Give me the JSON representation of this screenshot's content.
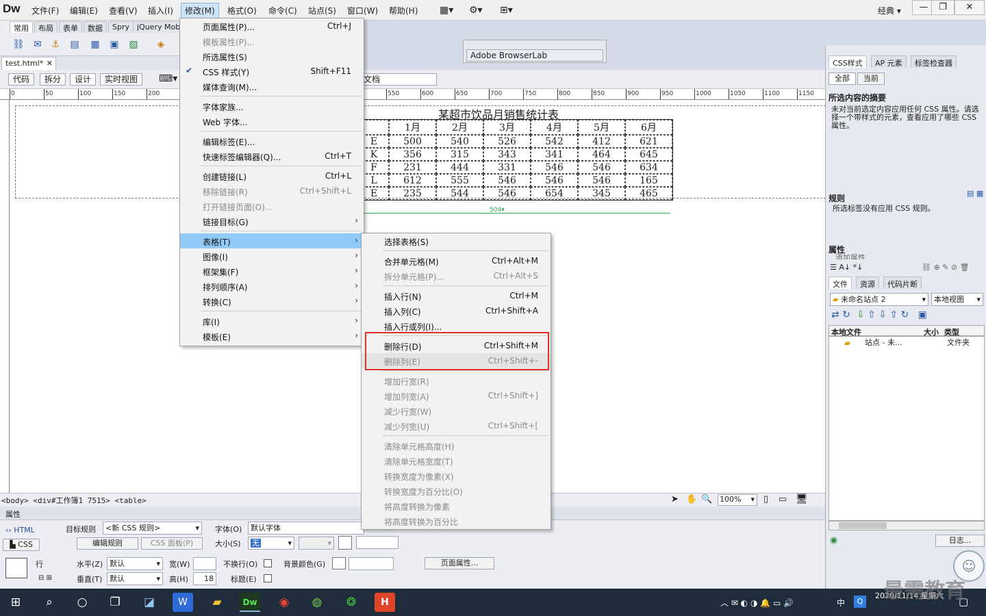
{
  "app": {
    "logo": "Dw",
    "workspace": "经典",
    "menubar": [
      "文件(F)",
      "编辑(E)",
      "查看(V)",
      "插入(I)",
      "修改(M)",
      "格式(O)",
      "命令(C)",
      "站点(S)",
      "窗口(W)",
      "帮助(H)"
    ]
  },
  "insert_panel": {
    "tabs": [
      "常用",
      "布局",
      "表单",
      "数据",
      "Spry",
      "jQuery Mob"
    ]
  },
  "document": {
    "tab": "test.html*",
    "view_buttons": [
      "代码",
      "拆分",
      "设计",
      "实时视图"
    ],
    "title_value": "文档",
    "ruler_labels": [
      "0",
      "50",
      "100",
      "150",
      "200",
      "550",
      "600",
      "650",
      "700",
      "750",
      "800",
      "850",
      "900",
      "950",
      "1000",
      "1050",
      "1100",
      "1150"
    ],
    "table_title": "某超市饮品月销售统计表",
    "table": {
      "header": [
        "",
        "1月",
        "2月",
        "3月",
        "4月",
        "5月",
        "6月"
      ],
      "rows": [
        [
          "E",
          "500",
          "540",
          "526",
          "542",
          "412",
          "621"
        ],
        [
          "K",
          "356",
          "315",
          "343",
          "341",
          "464",
          "645"
        ],
        [
          "F",
          "231",
          "444",
          "331",
          "546",
          "546",
          "634"
        ],
        [
          "L",
          "612",
          "555",
          "546",
          "546",
          "546",
          "165"
        ],
        [
          "E",
          "235",
          "544",
          "546",
          "654",
          "345",
          "465"
        ]
      ]
    },
    "table_width_label": "504",
    "tag_path": "<body> <div#工作簿1 7515> <table>",
    "zoom": "100%"
  },
  "browserlab": {
    "title": "Adobe BrowserLab"
  },
  "modify_menu": {
    "items": [
      {
        "label": "页面属性(P)...",
        "shortcut": "Ctrl+J"
      },
      {
        "label": "模板属性(P)...",
        "disabled": true
      },
      {
        "label": "所选属性(S)"
      },
      {
        "label": "CSS 样式(Y)",
        "shortcut": "Shift+F11",
        "checked": true
      },
      {
        "label": "媒体查询(M)..."
      },
      {
        "label": "字体家族..."
      },
      {
        "label": "Web 字体..."
      },
      {
        "label": "编辑标签(E)..."
      },
      {
        "label": "快速标签编辑器(Q)...",
        "shortcut": "Ctrl+T"
      },
      {
        "label": "创建链接(L)",
        "shortcut": "Ctrl+L"
      },
      {
        "label": "移除链接(R)",
        "shortcut": "Ctrl+Shift+L",
        "disabled": true
      },
      {
        "label": "打开链接页面(O)...",
        "disabled": true
      },
      {
        "label": "链接目标(G)",
        "submenu": true
      },
      {
        "label": "表格(T)",
        "submenu": true,
        "highlighted": true
      },
      {
        "label": "图像(I)",
        "submenu": true
      },
      {
        "label": "框架集(F)",
        "submenu": true
      },
      {
        "label": "排列顺序(A)",
        "submenu": true
      },
      {
        "label": "转换(C)",
        "submenu": true
      },
      {
        "label": "库(I)",
        "submenu": true
      },
      {
        "label": "模板(E)",
        "submenu": true
      }
    ]
  },
  "table_submenu": {
    "items": [
      {
        "label": "选择表格(S)"
      },
      {
        "label": "合并单元格(M)",
        "shortcut": "Ctrl+Alt+M"
      },
      {
        "label": "拆分单元格(P)...",
        "shortcut": "Ctrl+Alt+S",
        "disabled": true
      },
      {
        "label": "插入行(N)",
        "shortcut": "Ctrl+M"
      },
      {
        "label": "插入列(C)",
        "shortcut": "Ctrl+Shift+A"
      },
      {
        "label": "插入行或列(I)..."
      },
      {
        "label": "删除行(D)",
        "shortcut": "Ctrl+Shift+M"
      },
      {
        "label": "删除列(E)",
        "shortcut": "Ctrl+Shift+-",
        "disabled": true
      },
      {
        "label": "增加行宽(R)",
        "disabled": true
      },
      {
        "label": "增加列宽(A)",
        "shortcut": "Ctrl+Shift+]",
        "disabled": true
      },
      {
        "label": "减少行宽(W)",
        "disabled": true
      },
      {
        "label": "减少列宽(U)",
        "shortcut": "Ctrl+Shift+[",
        "disabled": true
      },
      {
        "label": "清除单元格高度(H)",
        "disabled": true
      },
      {
        "label": "清除单元格宽度(T)",
        "disabled": true
      },
      {
        "label": "转换宽度为像素(X)",
        "disabled": true
      },
      {
        "label": "转换宽度为百分比(O)",
        "disabled": true
      },
      {
        "label": "将高度转换为像素",
        "disabled": true
      },
      {
        "label": "将高度转换为百分比",
        "disabled": true
      }
    ]
  },
  "properties": {
    "title": "属性",
    "html_tab": "HTML",
    "css_tab": "CSS",
    "target_rule_label": "目标规则",
    "target_rule_value": "<新 CSS 规则>",
    "edit_rule_button": "编辑规则",
    "css_panel_button": "CSS 面板(P)",
    "font_label": "字体(O)",
    "font_value": "默认字体",
    "size_label": "大小(S)",
    "size_value": "无",
    "row_label": "行",
    "horiz_label": "水平(Z)",
    "horiz_value": "默认",
    "vert_label": "垂直(T)",
    "vert_value": "默认",
    "width_label": "宽(W)",
    "height_label": "高(H)",
    "height_value": "18",
    "nowrap_label": "不换行(O)",
    "header_label": "标题(E)",
    "bg_label": "背景颜色(G)",
    "page_props_button": "页面属性..."
  },
  "right_panel": {
    "css_tabs": [
      "CSS样式",
      "AP 元素",
      "标签检查器"
    ],
    "mode_buttons": [
      "全部",
      "当前"
    ],
    "summary_heading": "所选内容的摘要",
    "summary_text": "未对当前选定内容应用任何 CSS 属性。请选择一个带样式的元素，查看应用了哪些 CSS 属性。",
    "rules_heading": "规则",
    "rules_text": "所选标签没有应用 CSS 规则。",
    "props_heading": "属性",
    "props_add": "添加属性",
    "file_tabs": [
      "文件",
      "资源",
      "代码片断"
    ],
    "site_select": "未命名站点 2",
    "view_select": "本地视图",
    "cols": [
      "本地文件",
      "大小",
      "类型"
    ],
    "row_name": "站点 - 未...",
    "row_type": "文件夹",
    "log_button": "日志..."
  },
  "taskbar": {
    "time": "",
    "date": "2020/11/14 星期六",
    "ime": "中"
  },
  "watermark": "最需教育"
}
